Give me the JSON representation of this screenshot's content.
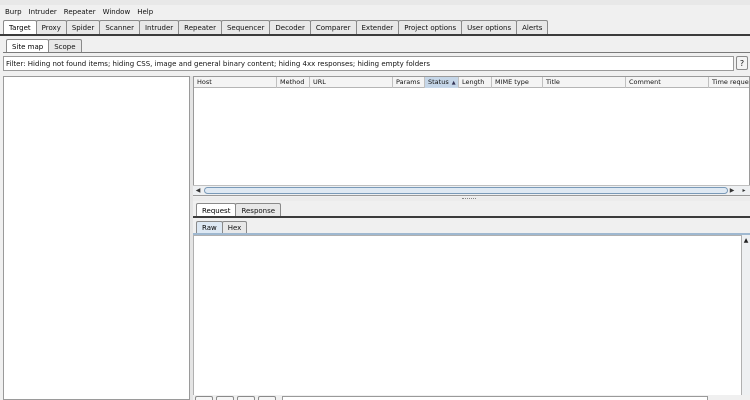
{
  "menu": [
    "Burp",
    "Intruder",
    "Repeater",
    "Window",
    "Help"
  ],
  "main_tabs": [
    "Target",
    "Proxy",
    "Spider",
    "Scanner",
    "Intruder",
    "Repeater",
    "Sequencer",
    "Decoder",
    "Comparer",
    "Extender",
    "Project options",
    "User options",
    "Alerts"
  ],
  "active_main_tab": "Target",
  "sub_tabs": [
    "Site map",
    "Scope"
  ],
  "active_sub_tab": "Site map",
  "filter_text": "Filter: Hiding not found items;  hiding CSS, image and general binary content;  hiding 4xx responses;  hiding empty folders",
  "help_label": "?",
  "table": {
    "columns": [
      "Host",
      "Method",
      "URL",
      "Params",
      "Status",
      "Length",
      "MIME type",
      "Title",
      "Comment",
      "Time request"
    ],
    "sorted_column": "Status",
    "sort_direction": "ascending",
    "rows": []
  },
  "request_tabs": [
    "Request",
    "Response"
  ],
  "active_request_tab": "Request",
  "view_tabs": [
    "Raw",
    "Hex"
  ],
  "active_view_tab": "Raw",
  "colors": {
    "tab_border": "#8a8a8a",
    "sorted_header": "#c5d6e8",
    "accent_line": "#3b3b3b"
  }
}
